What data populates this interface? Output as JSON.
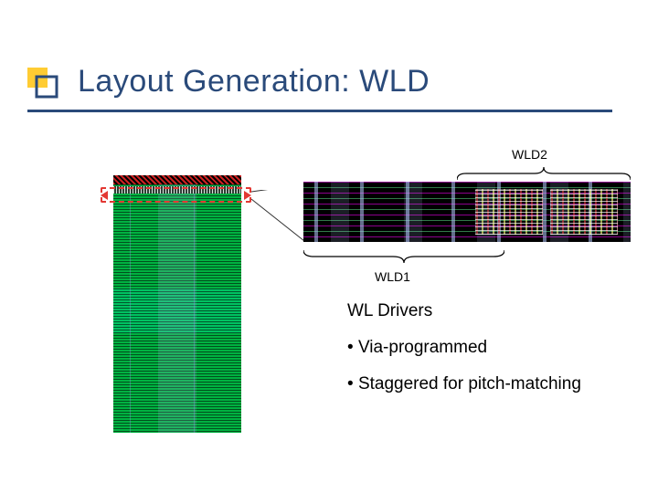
{
  "title": "Layout Generation: WLD",
  "labels": {
    "wld2": "WLD2",
    "wld1": "WLD1"
  },
  "content": {
    "subtitle": "WL Drivers",
    "bullets": [
      "Via-programmed",
      "Staggered for pitch-matching"
    ]
  },
  "colors": {
    "accent": "#2A4A7A",
    "bullet_fill": "#FFCC33",
    "highlight": "#e33833"
  }
}
